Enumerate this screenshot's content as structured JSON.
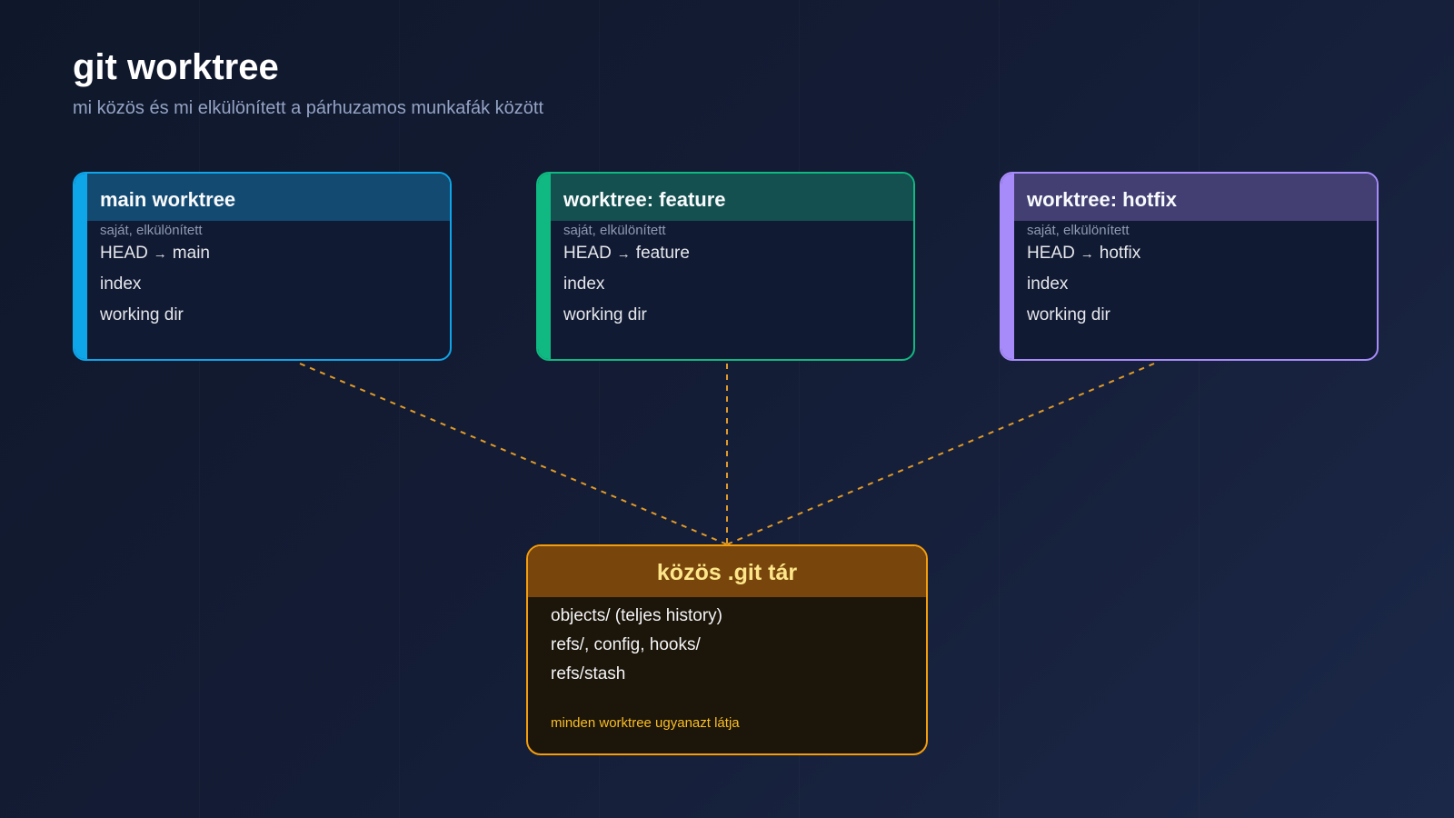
{
  "header": {
    "title": "git worktree",
    "subtitle": "mi közös és mi elkülönített a párhuzamos munkafák között"
  },
  "worktrees": [
    {
      "title": "main worktree",
      "caption": "saját, elkülönített",
      "head_label": "HEAD",
      "arrow": "→",
      "branch": "main",
      "items": [
        "index",
        "working dir"
      ],
      "accent": "#0ea5e9",
      "header_bg": "#134a72"
    },
    {
      "title": "worktree: feature",
      "caption": "saját, elkülönített",
      "head_label": "HEAD",
      "arrow": "→",
      "branch": "feature",
      "items": [
        "index",
        "working dir"
      ],
      "accent": "#10b981",
      "header_bg": "#14504f"
    },
    {
      "title": "worktree: hotfix",
      "caption": "saját, elkülönített",
      "head_label": "HEAD",
      "arrow": "→",
      "branch": "hotfix",
      "items": [
        "index",
        "working dir"
      ],
      "accent": "#a78bfa",
      "header_bg": "#433f73"
    }
  ],
  "repo": {
    "title": "közös .git tár",
    "items": [
      "objects/ (teljes history)",
      "refs/, config, hooks/",
      "refs/stash"
    ],
    "note": "minden worktree ugyanazt látja",
    "accent": "#f59e0b"
  }
}
